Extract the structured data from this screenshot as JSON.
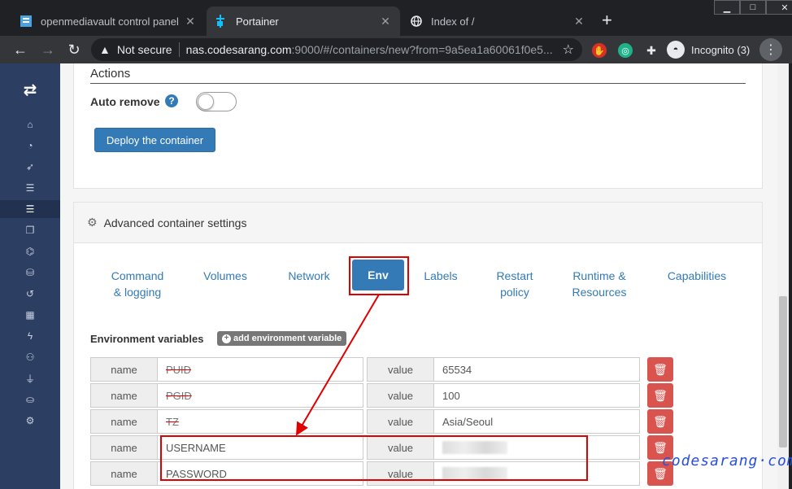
{
  "browser": {
    "tabs": [
      {
        "title": "openmediavault control panel - l",
        "icon": "omv-icon"
      },
      {
        "title": "Portainer",
        "icon": "portainer-icon"
      },
      {
        "title": "Index of /",
        "icon": "globe-icon"
      }
    ],
    "new_tab": "+",
    "security_label": "Not secure",
    "url_host": "nas.codesarang.com",
    "url_path": ":9000/#/containers/new?from=9a5ea1a60061f0e5...",
    "incognito_label": "Incognito (3)"
  },
  "actions": {
    "section_title": "Actions",
    "auto_remove_label": "Auto remove",
    "help_glyph": "?",
    "auto_remove_on": false,
    "deploy_label": "Deploy the container"
  },
  "advanced": {
    "title": "Advanced container settings",
    "tabs": [
      {
        "label": "Command\n& logging"
      },
      {
        "label": "Volumes"
      },
      {
        "label": "Network"
      },
      {
        "label": "Env"
      },
      {
        "label": "Labels"
      },
      {
        "label": "Restart\npolicy"
      },
      {
        "label": "Runtime &\nResources"
      },
      {
        "label": "Capabilities"
      }
    ],
    "active_tab": "Env"
  },
  "env": {
    "label": "Environment variables",
    "add_label": "add environment variable",
    "name_addon": "name",
    "value_addon": "value",
    "rows": [
      {
        "name": "PUID",
        "value": "65534"
      },
      {
        "name": "PGID",
        "value": "100"
      },
      {
        "name": "TZ",
        "value": "Asia/Seoul"
      },
      {
        "name": "USERNAME",
        "value": ""
      },
      {
        "name": "PASSWORD",
        "value": ""
      }
    ]
  },
  "watermark": "codesarang·com",
  "colors": {
    "accent": "#337ab7",
    "sidebar": "#2d3e63",
    "danger": "#d9534f",
    "highlight": "#e00000"
  }
}
